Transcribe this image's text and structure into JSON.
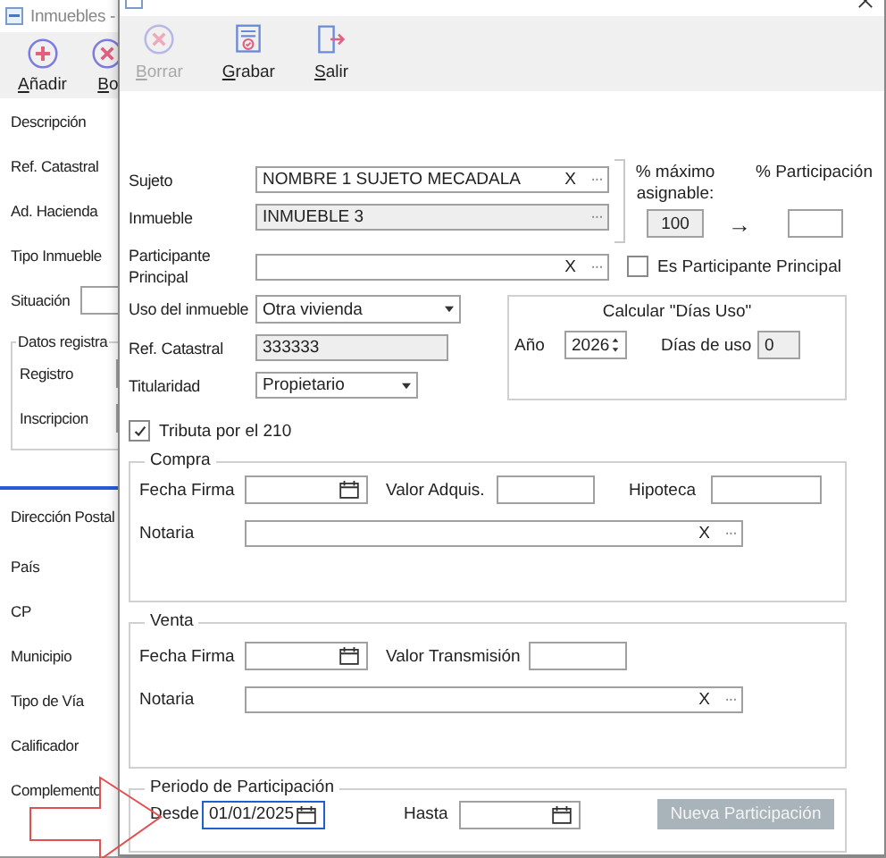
{
  "background_window": {
    "title": "Inmuebles -",
    "toolbar": [
      {
        "label": "Añadir"
      },
      {
        "label": "Bo"
      }
    ],
    "fields": [
      {
        "label": "Descripción",
        "kind": "text"
      },
      {
        "label": "Ref. Catastral",
        "kind": "text"
      },
      {
        "label": "Ad. Hacienda",
        "kind": "text"
      },
      {
        "label": "Tipo Inmueble",
        "kind": "text"
      },
      {
        "label": "Situación",
        "kind": "input"
      }
    ],
    "registry_group": {
      "title": "Datos registra",
      "fields": [
        {
          "label": "Registro"
        },
        {
          "label": "Inscripcion"
        }
      ]
    },
    "address_fields": [
      "Dirección Postal",
      "País",
      "CP",
      "Municipio",
      "Tipo de Vía",
      "Calificador",
      "Complemento"
    ]
  },
  "dialog": {
    "toolbar": [
      {
        "label": "Borrar",
        "disabled": true
      },
      {
        "label": "Grabar",
        "disabled": false
      },
      {
        "label": "Salir",
        "disabled": false
      }
    ],
    "sujeto": {
      "label": "Sujeto",
      "value": "NOMBRE 1 SUJETO MECADALA",
      "clear": "X",
      "browse": "···",
      "readonly": false
    },
    "inmueble": {
      "label": "Inmueble",
      "value": "INMUEBLE 3",
      "browse": "···",
      "readonly": true
    },
    "participante_principal": {
      "label": "Participante Principal",
      "clear": "X",
      "browse": "···",
      "readonly": false
    },
    "max_asignable": {
      "label": "% máximo asignable:",
      "value": "100",
      "readonly": true
    },
    "arrow": "→",
    "participacion": {
      "label": "% Participación"
    },
    "es_principal": {
      "label": "Es Participante Principal",
      "checked": false
    },
    "uso": {
      "label": "Uso del inmueble",
      "value": "Otra vivienda"
    },
    "ref_catastral": {
      "label": "Ref. Catastral",
      "value": "333333",
      "readonly": true
    },
    "titularidad": {
      "label": "Titularidad",
      "value": "Propietario"
    },
    "dias_uso": {
      "title": "Calcular \"Días Uso\"",
      "year_label": "Año",
      "year": "2026",
      "days_label": "Días de uso",
      "days": "0",
      "days_readonly": true
    },
    "tributa_210": {
      "label": "Tributa por el 210",
      "checked": true
    },
    "compra": {
      "title": "Compra",
      "fecha_label": "Fecha Firma",
      "valor_label": "Valor Adquis.",
      "hipoteca_label": "Hipoteca",
      "notaria_label": "Notaria",
      "notaria_clear": "X",
      "notaria_browse": "···"
    },
    "venta": {
      "title": "Venta",
      "fecha_label": "Fecha Firma",
      "valor_label": "Valor Transmisión",
      "notaria_label": "Notaria",
      "notaria_clear": "X",
      "notaria_browse": "···"
    },
    "periodo": {
      "title": "Periodo de  Participación",
      "desde_label": "Desde",
      "desde": "01/01/2025",
      "desde_focused": true,
      "hasta_label": "Hasta",
      "button": "Nueva Participación",
      "button_disabled": true
    }
  }
}
